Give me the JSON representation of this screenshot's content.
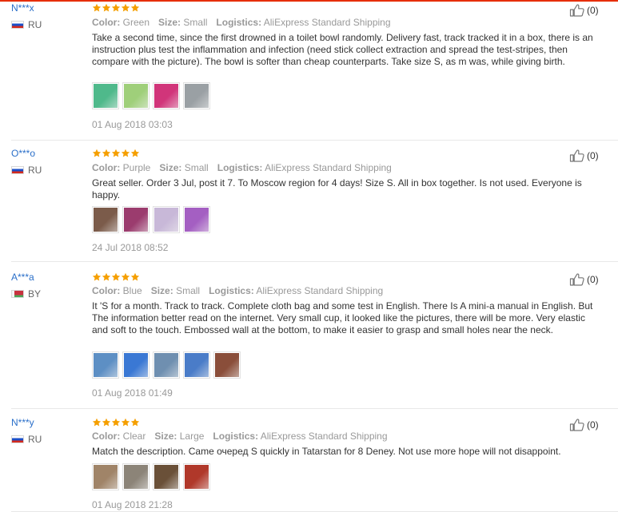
{
  "labels": {
    "color": "Color:",
    "size": "Size:",
    "logistics": "Logistics:"
  },
  "reviews": [
    {
      "user": "N***x",
      "country": "RU",
      "flag": "ru",
      "stars": 5,
      "color": "Green",
      "size": "Small",
      "logistics": "AliExpress Standard Shipping",
      "text": "Take a second time, since the first drowned in a toilet bowl randomly. Delivery fast, track tracked it in a box, there is an instruction plus test the inflammation and infection (need stick collect extraction and spread the test-stripes, then compare with the picture). The bowl is softer than cheap counterparts. Take size S, as m was, while giving birth.",
      "photos": [
        "#4fb98b",
        "#9fcf7a",
        "#d1357a",
        "#9aa0a4"
      ],
      "date": "01 Aug 2018 03:03",
      "helpful": "(0)"
    },
    {
      "user": "O***o",
      "country": "RU",
      "flag": "ru",
      "stars": 5,
      "color": "Purple",
      "size": "Small",
      "logistics": "AliExpress Standard Shipping",
      "text": "Great seller. Order 3 Jul, post it 7. To Moscow region for 4 days! Size S. All in box together. Is not used. Everyone is happy.",
      "photos": [
        "#7b5b4a",
        "#9b3c6e",
        "#c8b8d8",
        "#a45fc2"
      ],
      "date": "24 Jul 2018 08:52",
      "helpful": "(0)"
    },
    {
      "user": "A***a",
      "country": "BY",
      "flag": "by",
      "stars": 5,
      "color": "Blue",
      "size": "Small",
      "logistics": "AliExpress Standard Shipping",
      "text": "It 'S for a month. Track to track. Complete cloth bag and some test in English. There Is A mini-a manual in English. But The information better read on the internet. Very small cup, it looked like the pictures, there will be more. Very elastic and soft to the touch. Embossed wall at the bottom, to make it easier to grasp and small holes near the neck.",
      "photos": [
        "#5d8fc4",
        "#3a78d4",
        "#6f8fb0",
        "#4a7cc8",
        "#8a4e3a"
      ],
      "date": "01 Aug 2018 01:49",
      "helpful": "(0)"
    },
    {
      "user": "N***y",
      "country": "RU",
      "flag": "ru",
      "stars": 5,
      "color": "Clear",
      "size": "Large",
      "logistics": "AliExpress Standard Shipping",
      "text": "Match the description. Came очеред S quickly in Tatarstan for 8 Deney. Not use more hope will not disappoint.",
      "photos": [
        "#a08468",
        "#8c8478",
        "#6a5038",
        "#b0382a"
      ],
      "date": "01 Aug 2018 21:28",
      "helpful": "(0)"
    }
  ],
  "colors": {
    "name_link": "#2a6fc9",
    "star": "#f59f00",
    "muted": "#999999",
    "top_accent": "#e62e04"
  },
  "icons": {
    "rating": "star-icon",
    "helpful": "thumbs-up-icon"
  }
}
